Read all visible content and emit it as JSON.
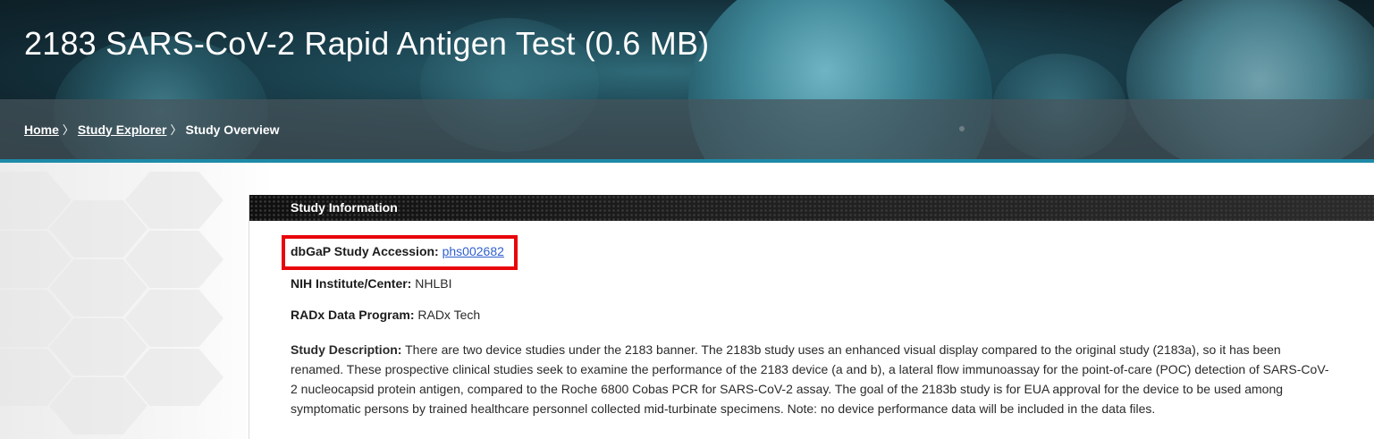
{
  "page": {
    "title": "2183 SARS-CoV-2 Rapid Antigen Test (0.6 MB)"
  },
  "breadcrumb": {
    "items": [
      {
        "label": "Home"
      },
      {
        "label": "Study Explorer"
      },
      {
        "label": "Study Overview"
      }
    ],
    "separator": "〉"
  },
  "study_info": {
    "header": "Study Information",
    "accession_label": "dbGaP Study Accession:",
    "accession_value": "phs002682",
    "institute_label": "NIH Institute/Center:",
    "institute_value": "NHLBI",
    "program_label": "RADx Data Program:",
    "program_value": "RADx Tech",
    "description_label": "Study Description:",
    "description_value": "There are two device studies under the 2183 banner. The 2183b study uses an enhanced visual display compared to the original study (2183a), so it has been renamed. These prospective clinical studies seek to examine the performance of the 2183 device (a and b), a lateral flow immunoassay for the point-of-care (POC) detection of SARS-CoV-2 nucleocapsid protein antigen, compared to the Roche 6800 Cobas PCR for SARS-CoV-2 assay. The goal of the 2183b study is for EUA approval for the device to be used among symptomatic persons by trained healthcare personnel collected mid-turbinate specimens. Note: no device performance data will be included in the data files."
  },
  "colors": {
    "accent": "#1e8aa8",
    "link": "#2f5fd0",
    "highlight": "#e8050b"
  }
}
